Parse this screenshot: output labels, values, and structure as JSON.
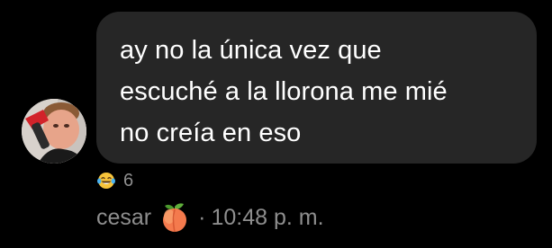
{
  "message": {
    "text": "ay no la única vez que\nescuché a la llorona me mié\nno creía en eso",
    "bubble_color": "#262626",
    "text_color": "#ffffff"
  },
  "reaction": {
    "emoji_icon": "laughing-tears-emoji-icon",
    "count": "6"
  },
  "meta": {
    "sender_name": "cesar",
    "sender_emoji_icon": "peach-emoji-icon",
    "separator": "·",
    "time": "10:48 p. m.",
    "text_color": "#8e8e8e"
  },
  "avatar": {
    "icon": "avatar-photo"
  }
}
